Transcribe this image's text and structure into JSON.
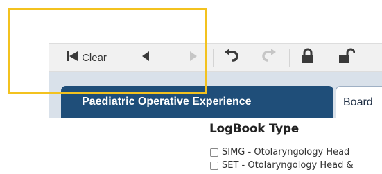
{
  "toolbar": {
    "first_icon": "skip-to-start-icon",
    "clear_label": "Clear",
    "prev_icon": "caret-left-icon",
    "next_icon": "caret-right-icon",
    "undo_icon": "undo-icon",
    "redo_icon": "redo-icon",
    "lock_icon": "lock-icon",
    "unlock_icon": "unlock-icon"
  },
  "tabs": [
    {
      "label": "Paediatric Operative Experience",
      "active": true
    },
    {
      "label": "Board",
      "active": false
    }
  ],
  "logbook": {
    "title": "LogBook Type",
    "options": [
      {
        "label": "SIMG - Otolaryngology Head",
        "checked": false
      },
      {
        "label": "SET - Otolaryngology Head &",
        "checked": false
      }
    ]
  },
  "colors": {
    "highlight": "#f3c21f",
    "active_tab": "#1f4e79",
    "tab_band": "#d9e1ea"
  }
}
